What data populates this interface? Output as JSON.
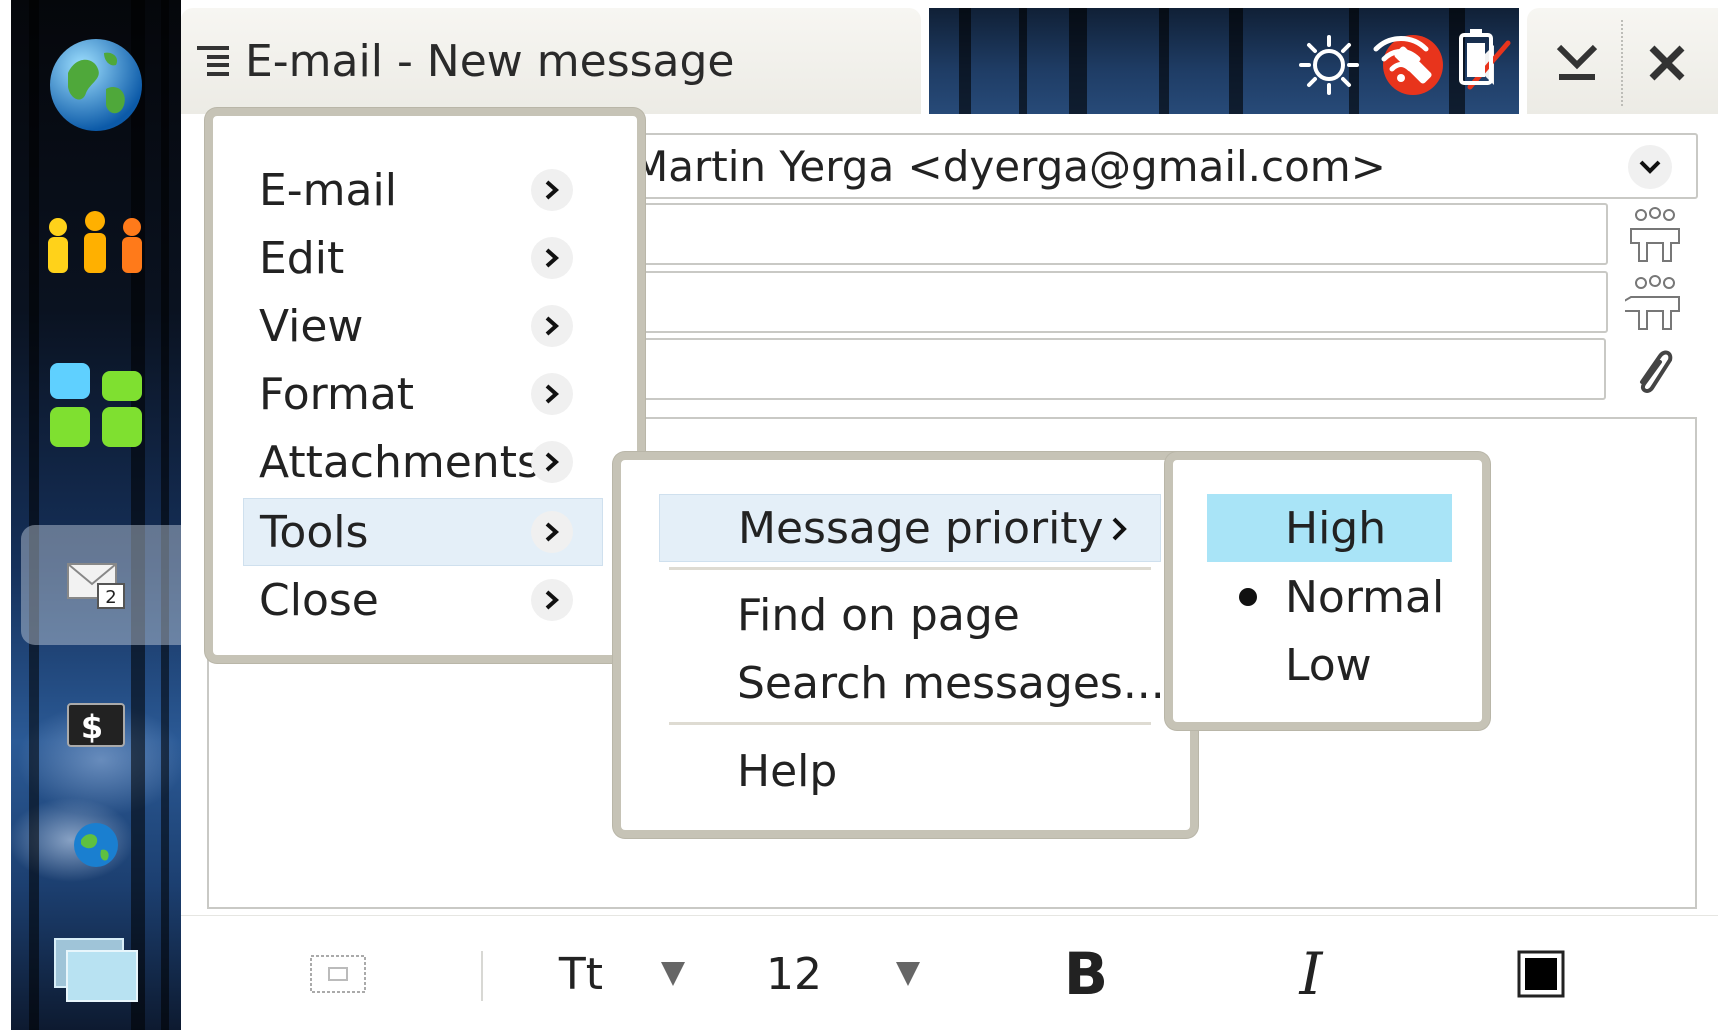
{
  "window": {
    "title": "E-mail - New message"
  },
  "sidebar": {
    "items": [
      {
        "id": "web",
        "icon": "globe-icon"
      },
      {
        "id": "contacts",
        "icon": "people-icon"
      },
      {
        "id": "applications",
        "icon": "app-grid-icon"
      },
      {
        "id": "email",
        "icon": "envelope-icon",
        "badge": "2",
        "selected": true
      },
      {
        "id": "terminal",
        "icon": "terminal-icon"
      },
      {
        "id": "browser",
        "icon": "small-globe-icon"
      },
      {
        "id": "switcher",
        "icon": "task-switcher-icon"
      }
    ]
  },
  "status": {
    "icons": [
      "brightness-icon",
      "presence-busy-icon",
      "volume-muted-icon",
      "wifi-icon",
      "battery-icon"
    ]
  },
  "compose": {
    "from_value": "Martin Yerga <dyerga@gmail.com>",
    "to_value": "",
    "cc_value": "",
    "subject_value": ""
  },
  "toolbar": {
    "font_label": "Tt",
    "font_size": "12",
    "bold_label": "B",
    "italic_label": "I"
  },
  "main_menu": {
    "items": [
      {
        "label": "E-mail"
      },
      {
        "label": "Edit"
      },
      {
        "label": "View"
      },
      {
        "label": "Format"
      },
      {
        "label": "Attachments"
      },
      {
        "label": "Tools",
        "active": true
      },
      {
        "label": "Close"
      }
    ]
  },
  "tools_menu": {
    "items": [
      {
        "label": "Message priority",
        "submenu": true,
        "active": true
      },
      {
        "label": "Find on page"
      },
      {
        "label": "Search messages..."
      },
      {
        "label": "Help"
      }
    ]
  },
  "priority_menu": {
    "items": [
      {
        "label": "High",
        "highlighted": true
      },
      {
        "label": "Normal",
        "selected": true
      },
      {
        "label": "Low"
      }
    ]
  },
  "colors": {
    "highlight": "#a9e4f7",
    "active_row": "#e4eff8",
    "menu_border": "#c6c3b6"
  }
}
